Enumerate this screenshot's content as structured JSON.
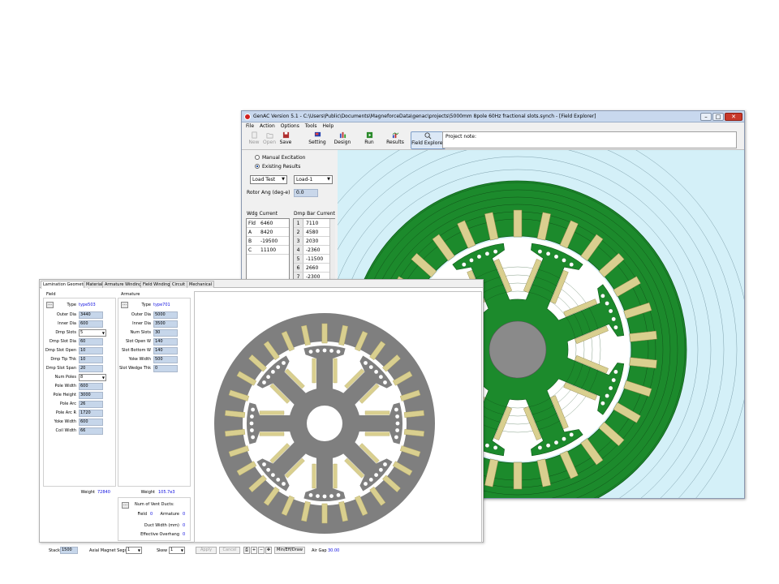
{
  "genac": {
    "title": "GenAC Version 5.1 - C:\\Users\\Public\\Documents\\MagneforceData\\genac\\projects\\5000mm 8pole 60Hz fractional slots.synch - [Field Explorer]",
    "menu": [
      "File",
      "Action",
      "Options",
      "Tools",
      "Help"
    ],
    "toolbar": {
      "new": "New",
      "open": "Open",
      "save": "Save",
      "setting": "Setting",
      "design": "Design",
      "run": "Run",
      "results": "Results",
      "field_explorer": "Field Explorer"
    },
    "project_note": "Project note:",
    "excitation": {
      "manual": "Manual Excitation",
      "existing": "Existing Results"
    },
    "load_test": "Load Test",
    "load_case": "Load-1",
    "rotor_ang_label": "Rotor Ang (deg-e)",
    "rotor_ang_value": "0.0",
    "wdg_current_label": "Wdg Current",
    "dmp_bar_current_label": "Dmp Bar Current",
    "wdg_rows": [
      {
        "name": "Fld",
        "value": "6460"
      },
      {
        "name": "A",
        "value": "8420"
      },
      {
        "name": "B",
        "value": "-19500"
      },
      {
        "name": "C",
        "value": "11100"
      }
    ],
    "dmp_rows": [
      {
        "idx": "1",
        "value": "7110"
      },
      {
        "idx": "2",
        "value": "4580"
      },
      {
        "idx": "3",
        "value": "2030"
      },
      {
        "idx": "4",
        "value": "-2360"
      },
      {
        "idx": "5",
        "value": "-11500"
      },
      {
        "idx": "6",
        "value": "2660"
      },
      {
        "idx": "7",
        "value": "-2300"
      }
    ]
  },
  "lamination": {
    "tabs": [
      "Lamination Geometry",
      "Material",
      "Armature Winding",
      "Field Winding",
      "Circuit",
      "Mechanical"
    ],
    "field": {
      "title": "Field",
      "type_label": "Type",
      "type_value": "type503",
      "params": [
        {
          "label": "Outer Dia",
          "value": "3440"
        },
        {
          "label": "Inner Dia",
          "value": "600"
        },
        {
          "label": "Dmp Slots",
          "value": "5",
          "combo": true
        },
        {
          "label": "Dmp Slot Dia",
          "value": "60"
        },
        {
          "label": "Dmp Slot Open",
          "value": "10"
        },
        {
          "label": "Dmp Tip Thk",
          "value": "10"
        },
        {
          "label": "Dmp Slot Span",
          "value": "20"
        },
        {
          "label": "Num Poles",
          "value": "8",
          "combo": true
        },
        {
          "label": "Pole Width",
          "value": "600"
        },
        {
          "label": "Pole Height",
          "value": "3000"
        },
        {
          "label": "Pole Arc",
          "value": "26"
        },
        {
          "label": "Pole Arc R",
          "value": "1720"
        },
        {
          "label": "Yoke Width",
          "value": "600"
        },
        {
          "label": "Coil Width",
          "value": "66"
        }
      ],
      "weight_label": "Weight",
      "weight_value": "72840"
    },
    "armature": {
      "title": "Armature",
      "type_label": "Type",
      "type_value": "type701",
      "params": [
        {
          "label": "Outer Dia",
          "value": "5000"
        },
        {
          "label": "Inner Dia",
          "value": "3500"
        },
        {
          "label": "Num Slots",
          "value": "30"
        },
        {
          "label": "Slot Open W",
          "value": "140"
        },
        {
          "label": "Slot Bottom W",
          "value": "140"
        },
        {
          "label": "Yoke Width",
          "value": "500"
        },
        {
          "label": "Slot Wedge Thk",
          "value": "0"
        }
      ],
      "weight_label": "Weight",
      "weight_value": "105.7e3"
    },
    "vent": {
      "title": "Num of Vent Ducts:",
      "field_label": "Field",
      "field_value": "0",
      "armature_label": "Armature",
      "armature_value": "0",
      "duct_width_label": "Duct Width (mm)",
      "duct_width_value": "0",
      "overhang_label": "Effective Overhang",
      "overhang_value": "0"
    },
    "bottom": {
      "stack_label": "Stack",
      "stack_value": "1500",
      "axial_label": "Axial Magnet Segs",
      "axial_value": "1",
      "skew_label": "Skew",
      "skew_value": "1",
      "apply": "Apply",
      "cancel": "Cancel",
      "minmax": "Min/Eff/Draw",
      "air_gap_label": "Air Gap",
      "air_gap_value": "30.00"
    }
  }
}
